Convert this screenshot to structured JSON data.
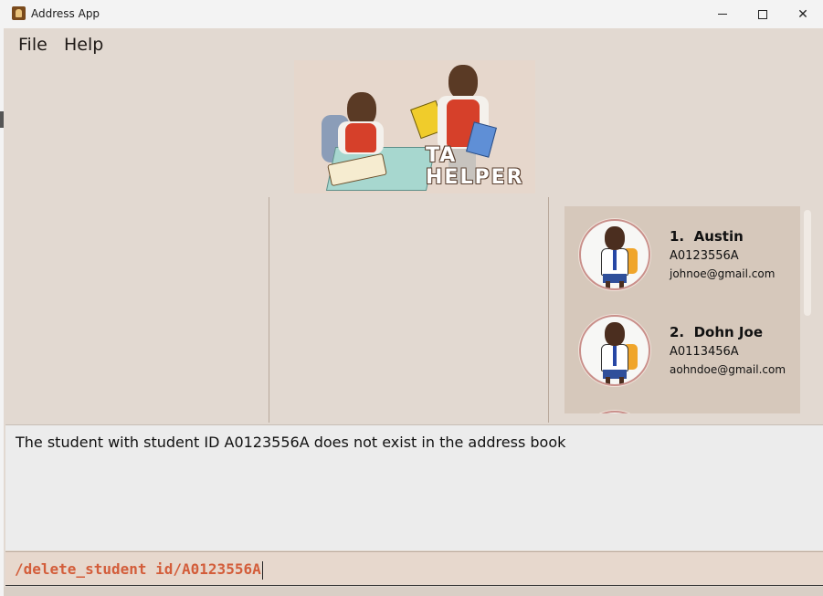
{
  "window": {
    "title": "Address App",
    "controls": {
      "minimize": "minimize-icon",
      "maximize": "maximize-icon",
      "close": "close-icon"
    }
  },
  "menu": {
    "items": [
      {
        "label": "File"
      },
      {
        "label": "Help"
      }
    ]
  },
  "logo": {
    "line1": "TA",
    "line2": "HELPER"
  },
  "students": [
    {
      "index": "1.",
      "name": "Austin",
      "student_id": "A0123556A",
      "email": "johnoe@gmail.com"
    },
    {
      "index": "2.",
      "name": "Dohn Joe",
      "student_id": "A0113456A",
      "email": "aohndoe@gmail.com"
    }
  ],
  "result": {
    "message": "The student with student ID A0123556A does not exist in the address book"
  },
  "command": {
    "value": "/delete_student id/A0123556A"
  },
  "colors": {
    "background": "#e2d9d1",
    "command_text": "#d35d3a",
    "list_panel": "#d6c8bb",
    "result_panel": "#ececec"
  }
}
